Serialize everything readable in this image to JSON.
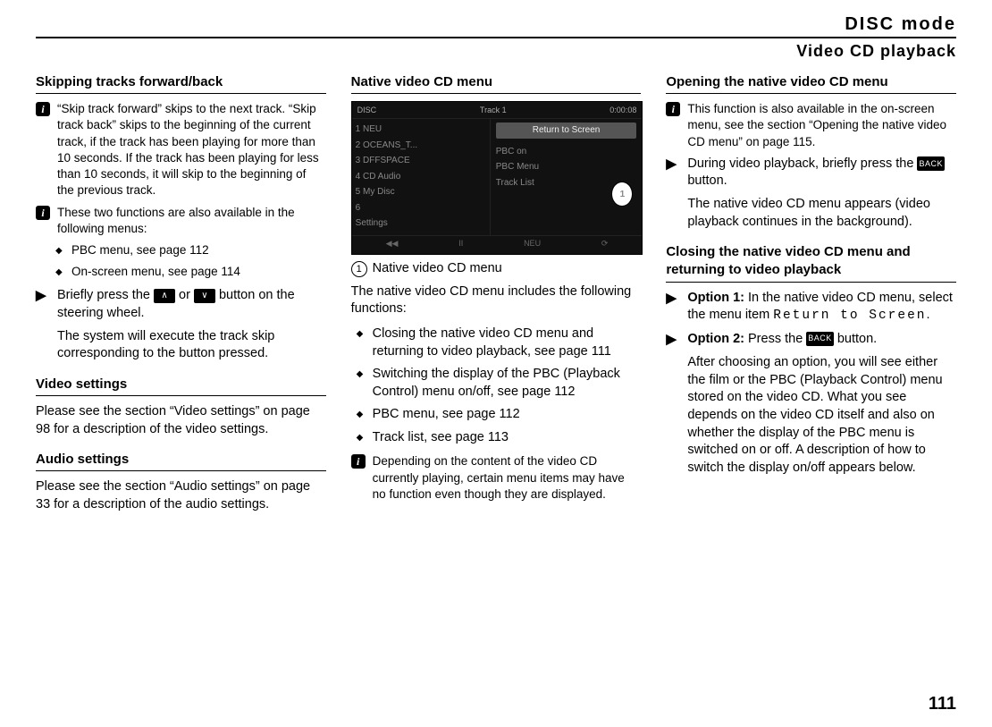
{
  "header": {
    "title": "DISC mode",
    "subtitle": "Video CD playback"
  },
  "col1": {
    "h_skip": "Skipping tracks forward/back",
    "info_skip": "“Skip track forward” skips to the next track. “Skip track back” skips to the beginning of the current track, if the track has been playing for more than 10 seconds. If the track has been playing for less than 10 seconds, it will skip to the beginning of the previous track.",
    "info_two": "These two functions are also available in the following menus:",
    "pbc_item": "PBC menu, see page 112",
    "onscreen_item": "On-screen menu, see page 114",
    "step_press1": "Briefly press the ",
    "step_press2": " or ",
    "step_press3": " button on the steering wheel.",
    "step_result": "The system will execute the track skip corresponding to the button pressed.",
    "h_video": "Video settings",
    "video_body": "Please see the section “Video settings” on page 98 for a description of the video settings.",
    "h_audio": "Audio settings",
    "audio_body": "Please see the section “Audio settings” on page 33 for a description of the audio settings."
  },
  "col2": {
    "h_native": "Native video CD menu",
    "ss": {
      "disc": "DISC",
      "track": "Track 1",
      "time": "0:00:08",
      "l1": "1  NEU",
      "l2": "2  OCEANS_T...",
      "l3": "3  DFFSPACE",
      "l4": "4  CD Audio",
      "l5": "5  My Disc",
      "l6": "6",
      "settings": "Settings",
      "ret": "Return to Screen",
      "r1": "PBC on",
      "r2": "PBC Menu",
      "r3": "Track List",
      "f1": "◀◀",
      "f2": "II",
      "f3": "NEU",
      "callout": "1"
    },
    "caption": "Native video CD menu",
    "intro": "The native video CD menu includes the following functions:",
    "li1": "Closing the native video CD menu and returning to video playback, see page 111",
    "li2": "Switching the display of the PBC (Playback Control) menu on/off, see page 112",
    "li3": "PBC menu, see page 112",
    "li4": "Track list, see page 113",
    "info_depend": "Depending on the content of the video CD currently playing, certain menu items may have no function even though they are displayed."
  },
  "col3": {
    "h_open": "Opening the native video CD menu",
    "info_avail": "This function is also available in the on-screen menu, see the section “Opening the native video CD menu” on page 115.",
    "step_open1": "During video playback, briefly press the ",
    "step_open2": " button.",
    "step_open_res": "The native video CD menu appears (video playback continues in the background).",
    "h_close": "Closing the native video CD menu and returning to video playback",
    "opt1a": "Option 1:",
    "opt1b": " In the native video CD menu, select the menu item ",
    "opt1c": "Return to Screen",
    "opt1d": ".",
    "opt2a": "Option 2:",
    "opt2b": " Press the ",
    "opt2c": " button.",
    "after": "After choosing an option, you will see either the film or the PBC (Playback Control) menu stored on the video CD. What you see depends on the video CD itself and also on whether the display of the PBC menu is switched on or off. A description of how to switch the display on/off appears below.",
    "back_label": "BACK"
  },
  "page_number": "111",
  "icons": {
    "up": "∧",
    "down": "∨",
    "arrow": "▶"
  }
}
